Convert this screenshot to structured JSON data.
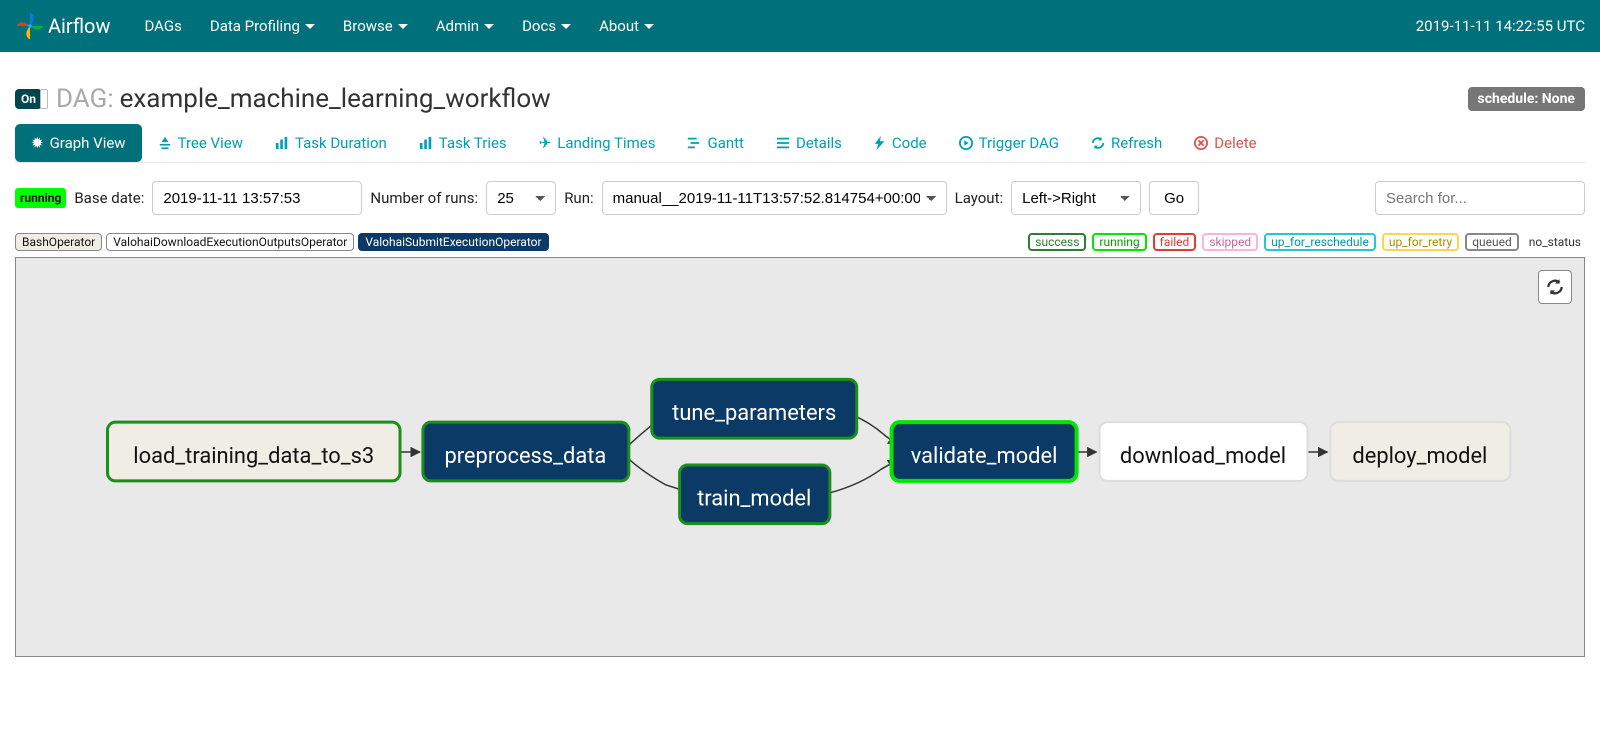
{
  "navbar": {
    "brand": "Airflow",
    "items": [
      "DAGs",
      "Data Profiling",
      "Browse",
      "Admin",
      "Docs",
      "About"
    ],
    "items_caret": [
      false,
      true,
      true,
      true,
      true,
      true
    ],
    "clock": "2019-11-11 14:22:55 UTC"
  },
  "header": {
    "toggle": "On",
    "dag_label": "DAG:",
    "dag_name": "example_machine_learning_workflow",
    "schedule": "schedule: None"
  },
  "tabs": {
    "graph": "Graph View",
    "tree": "Tree View",
    "duration": "Task Duration",
    "tries": "Task Tries",
    "landing": "Landing Times",
    "gantt": "Gantt",
    "details": "Details",
    "code": "Code",
    "trigger": "Trigger DAG",
    "refresh": "Refresh",
    "delete": "Delete"
  },
  "filters": {
    "running": "running",
    "base_date_label": "Base date:",
    "base_date": "2019-11-11 13:57:53",
    "num_runs_label": "Number of runs:",
    "num_runs": "25",
    "run_label": "Run:",
    "run": "manual__2019-11-11T13:57:52.814754+00:00",
    "layout_label": "Layout:",
    "layout": "Left->Right",
    "go": "Go",
    "search_placeholder": "Search for..."
  },
  "operators": {
    "bash": "BashOperator",
    "download": "ValohaiDownloadExecutionOutputsOperator",
    "submit": "ValohaiSubmitExecutionOperator"
  },
  "states": {
    "success": "success",
    "running": "running",
    "failed": "failed",
    "skipped": "skipped",
    "resched": "up_for_reschedule",
    "retry": "up_for_retry",
    "queued": "queued",
    "nostatus": "no_status"
  },
  "graph": {
    "nodes": {
      "load": "load_training_data_to_s3",
      "preprocess": "preprocess_data",
      "tune": "tune_parameters",
      "train": "train_model",
      "validate": "validate_model",
      "download": "download_model",
      "deploy": "deploy_model"
    }
  }
}
